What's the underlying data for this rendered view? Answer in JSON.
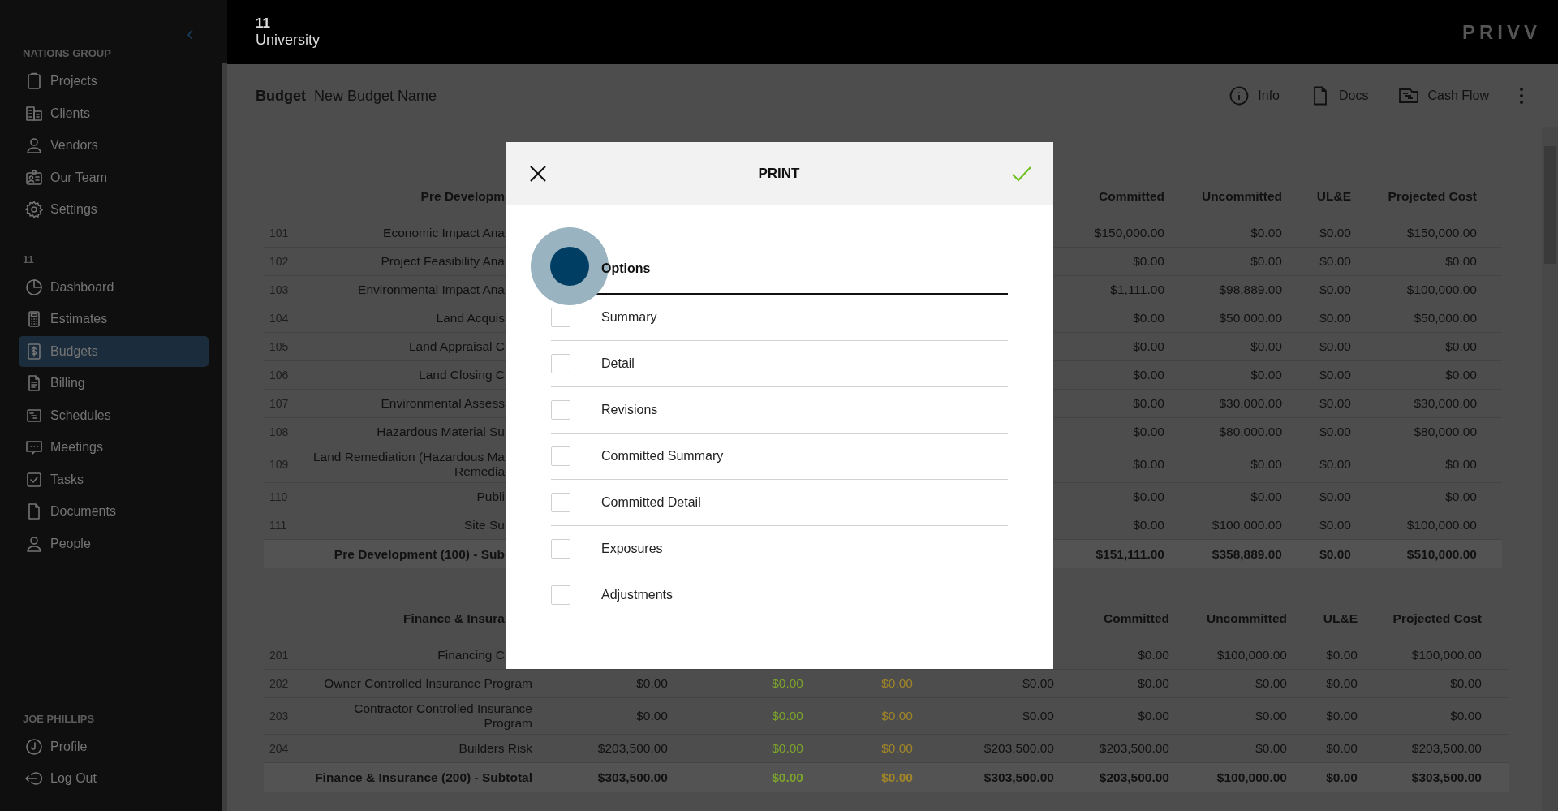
{
  "sidebar": {
    "collapse_icon": "‹",
    "sections": [
      {
        "label": "NATIONS GROUP",
        "items": [
          {
            "label": "Projects",
            "selected": false
          },
          {
            "label": "Clients",
            "selected": false
          },
          {
            "label": "Vendors",
            "selected": false
          },
          {
            "label": "Our Team",
            "selected": false
          },
          {
            "label": "Settings",
            "selected": false
          }
        ]
      },
      {
        "label": "11",
        "items": [
          {
            "label": "Dashboard",
            "selected": false
          },
          {
            "label": "Estimates",
            "selected": false
          },
          {
            "label": "Budgets",
            "selected": true
          },
          {
            "label": "Billing",
            "selected": false
          },
          {
            "label": "Schedules",
            "selected": false
          },
          {
            "label": "Meetings",
            "selected": false
          },
          {
            "label": "Tasks",
            "selected": false
          },
          {
            "label": "Documents",
            "selected": false
          },
          {
            "label": "People",
            "selected": false
          }
        ]
      },
      {
        "label": "JOE PHILLIPS",
        "items": [
          {
            "label": "Profile",
            "selected": false
          },
          {
            "label": "Log Out",
            "selected": false
          }
        ]
      }
    ]
  },
  "header": {
    "project_number": "11",
    "project_name": "University",
    "logo": "PRIVV"
  },
  "toolbar": {
    "title": "Budget",
    "budget_name": "New Budget Name",
    "actions": [
      {
        "label": "Info"
      },
      {
        "label": "Docs"
      },
      {
        "label": "Cash Flow"
      }
    ]
  },
  "sections": [
    {
      "header": {
        "label": "Pre Developm"
      },
      "columns": [
        "Committed",
        "Uncommitted",
        "UL&E",
        "Projected Cost"
      ],
      "rows": [
        {
          "kind": "item",
          "number": "101",
          "description": "Economic Impact Ana",
          "values": [
            "$150,000.00",
            "$0.00",
            "$0.00",
            "$150,000.00"
          ]
        },
        {
          "kind": "item",
          "number": "102",
          "description": "Project Feasibility Ana",
          "values": [
            "$0.00",
            "$0.00",
            "$0.00",
            "$0.00"
          ]
        },
        {
          "kind": "item",
          "number": "103",
          "description": "Environmental Impact Ana",
          "values": [
            "$1,111.00",
            "$98,889.00",
            "$0.00",
            "$100,000.00"
          ]
        },
        {
          "kind": "item",
          "number": "104",
          "description": "Land Acquis",
          "values": [
            "$0.00",
            "$50,000.00",
            "$0.00",
            "$50,000.00"
          ]
        },
        {
          "kind": "item",
          "number": "105",
          "description": "Land Appraisal C",
          "values": [
            "$0.00",
            "$0.00",
            "$0.00",
            "$0.00"
          ]
        },
        {
          "kind": "item",
          "number": "106",
          "description": "Land Closing C",
          "values": [
            "$0.00",
            "$0.00",
            "$0.00",
            "$0.00"
          ]
        },
        {
          "kind": "item",
          "number": "107",
          "description": "Environmental Assess",
          "values": [
            "$0.00",
            "$30,000.00",
            "$0.00",
            "$30,000.00"
          ]
        },
        {
          "kind": "item",
          "number": "108",
          "description": "Hazardous Material Su",
          "values": [
            "$0.00",
            "$80,000.00",
            "$0.00",
            "$80,000.00"
          ]
        },
        {
          "kind": "item",
          "number": "109",
          "description": "Land Remediation (Hazardous Ma\nRemedia",
          "values": [
            "$0.00",
            "$0.00",
            "$0.00",
            "$0.00"
          ]
        },
        {
          "kind": "item",
          "number": "110",
          "description": "Publi",
          "values": [
            "$0.00",
            "$0.00",
            "$0.00",
            "$0.00"
          ]
        },
        {
          "kind": "item",
          "number": "111",
          "description": "Site Su",
          "values": [
            "$0.00",
            "$100,000.00",
            "$0.00",
            "$100,000.00"
          ]
        },
        {
          "kind": "subtotal",
          "description": "Pre Development (100) - Sub",
          "values": [
            "$151,111.00",
            "$358,889.00",
            "$0.00",
            "$510,000.00"
          ]
        }
      ]
    },
    {
      "header": {
        "label": "Finance & Insura"
      },
      "columns": [
        "Committed",
        "Uncommitted",
        "UL&E",
        "Projected Cost"
      ],
      "value_columns": [
        {
          "color": "#111111"
        },
        {
          "color": "#7da42b"
        },
        {
          "color": "#a08528"
        },
        {
          "color": "#111111"
        },
        {
          "color": "#111111"
        },
        {
          "color": "#111111"
        },
        {
          "color": "#111111"
        },
        {
          "color": "#111111"
        }
      ],
      "rows": [
        {
          "kind": "item",
          "number": "201",
          "description": "Financing C",
          "values": [
            "$0.00",
            "$100,000.00",
            "$0.00",
            "$100,000.00"
          ]
        },
        {
          "kind": "item",
          "number": "202",
          "description": "Owner Controlled Insurance Program",
          "values": [
            "$0.00",
            "$0.00",
            "$0.00",
            "$0.00",
            "$0.00",
            "$0.00",
            "$0.00",
            "$0.00"
          ]
        },
        {
          "kind": "item",
          "number": "203",
          "description": "Contractor Controlled Insurance\nProgram",
          "values": [
            "$0.00",
            "$0.00",
            "$0.00",
            "$0.00",
            "$0.00",
            "$0.00",
            "$0.00",
            "$0.00"
          ]
        },
        {
          "kind": "item",
          "number": "204",
          "description": "Builders Risk",
          "values": [
            "$203,500.00",
            "$0.00",
            "$0.00",
            "$203,500.00",
            "$203,500.00",
            "$0.00",
            "$0.00",
            "$203,500.00"
          ]
        },
        {
          "kind": "subtotal",
          "description": "Finance & Insurance (200) - Subtotal",
          "values": [
            "$303,500.00",
            "$0.00",
            "$0.00",
            "$303,500.00",
            "$203,500.00",
            "$100,000.00",
            "$0.00",
            "$303,500.00"
          ]
        }
      ]
    }
  ],
  "dialog": {
    "title": "PRINT",
    "options_header": {
      "label": "Options",
      "pressed": true
    },
    "options": [
      {
        "label": "Summary",
        "checked": false
      },
      {
        "label": "Detail",
        "checked": false
      },
      {
        "label": "Revisions",
        "checked": false
      },
      {
        "label": "Committed Summary",
        "checked": false
      },
      {
        "label": "Committed Detail",
        "checked": false
      },
      {
        "label": "Exposures",
        "checked": false
      },
      {
        "label": "Adjustments",
        "checked": false
      }
    ]
  }
}
